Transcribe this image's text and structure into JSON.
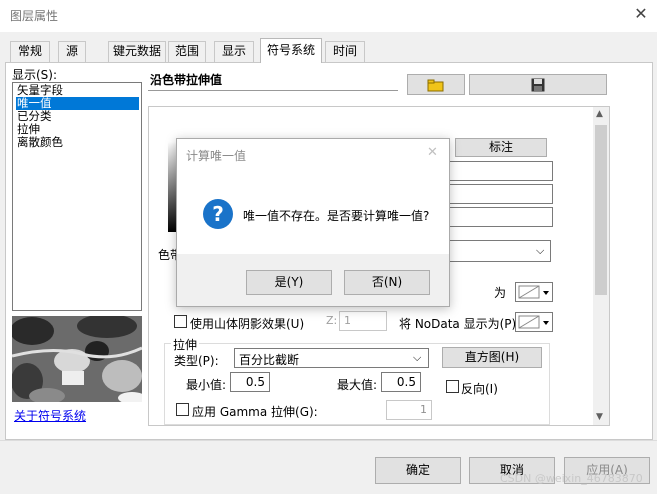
{
  "window": {
    "title": "图层属性",
    "close_glyph": "✕"
  },
  "tabs": [
    "常规",
    "源",
    "键元数据",
    "范围",
    "显示",
    "符号系统",
    "时间"
  ],
  "active_tab": "符号系统",
  "left": {
    "show_label": "显示(S):",
    "items": [
      "矢量字段",
      "唯一值",
      "已分类",
      "拉伸",
      "离散颜色"
    ],
    "selected": "唯一值",
    "about_link": "关于符号系统"
  },
  "right": {
    "heading": "沿色带拉伸值",
    "label_button": "标注",
    "ramp_label": "色带",
    "nodata_suffix": "为",
    "hillshade_label": "使用山体阴影效果(U)",
    "z_label": "Z:",
    "z_value": "1",
    "nodata_label": "将 NoData 显示为(P)",
    "stretch": {
      "group_label": "拉伸",
      "type_label": "类型(P):",
      "type_value": "百分比截断",
      "histogram_button": "直方图(H)",
      "min_label": "最小值:",
      "min_value": "0.5",
      "max_label": "最大值:",
      "max_value": "0.5",
      "invert_label": "反向(I)",
      "gamma_label": "应用 Gamma 拉伸(G):",
      "gamma_value": "1"
    }
  },
  "dialog": {
    "title": "计算唯一值",
    "close_glyph": "✕",
    "message": "唯一值不存在。是否要计算唯一值?",
    "icon_glyph": "?",
    "yes_button": "是(Y)",
    "no_button": "否(N)"
  },
  "footer": {
    "ok_button": "确定",
    "cancel_button": "取消",
    "apply_button": "应用(A)"
  },
  "watermark": "CSDN @weixin_46783870",
  "colors": {
    "accent": "#0078d7",
    "link": "#0000ee",
    "icon_blue": "#1a73c9"
  }
}
